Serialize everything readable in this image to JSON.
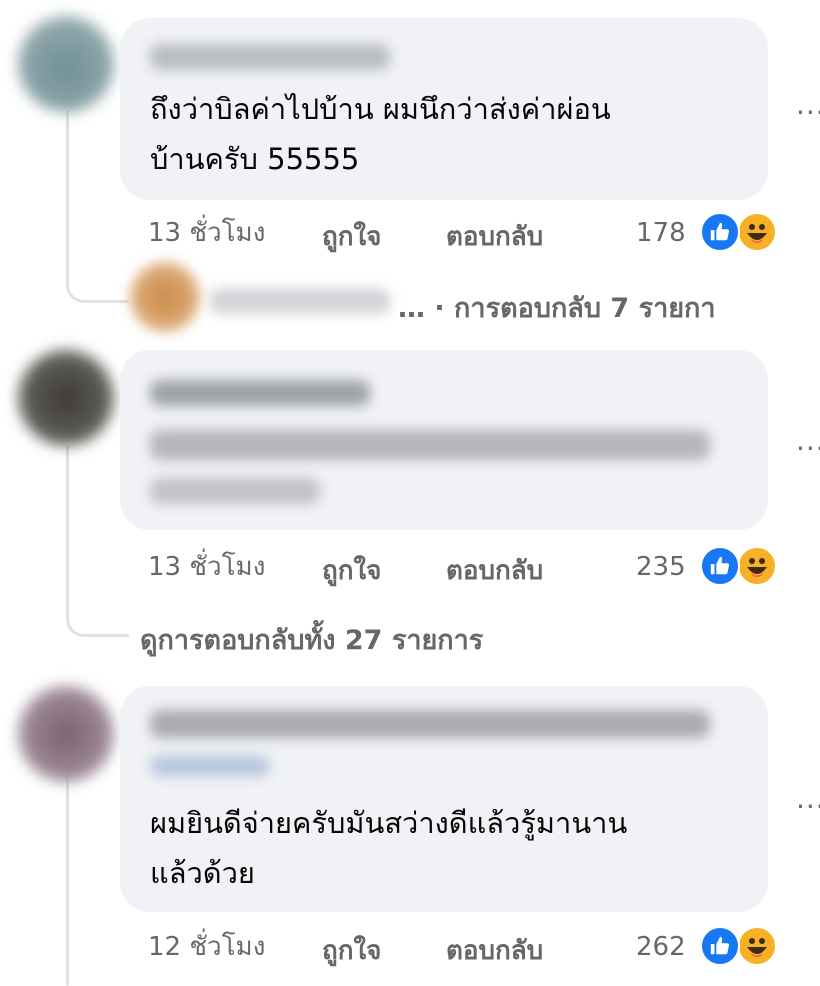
{
  "comments": [
    {
      "text_line1": "ถึงว่าบิลค่าไปบ้าน ผมนึกว่าส่งค่าผ่อน",
      "text_line2": "บ้านครับ 55555",
      "time": "13 ชั่วโมง",
      "like_label": "ถูกใจ",
      "reply_label": "ตอบกลับ",
      "reaction_count": "178",
      "reactions": [
        "like-icon",
        "haha-icon"
      ],
      "more_label": "..."
    },
    {
      "text_line1": "",
      "text_line2": "",
      "time": "13 ชั่วโมง",
      "like_label": "ถูกใจ",
      "reply_label": "ตอบกลับ",
      "reaction_count": "235",
      "reactions": [
        "like-icon",
        "haha-icon"
      ],
      "more_label": "..."
    },
    {
      "text_line1": "ผมยินดีจ่ายครับมันสว่างดีแล้วรู้มานาน",
      "text_line2": "แล้วด้วย",
      "time": "12 ชั่วโมง",
      "like_label": "ถูกใจ",
      "reply_label": "ตอบกลับ",
      "reaction_count": "262",
      "reactions": [
        "like-icon",
        "haha-icon"
      ],
      "more_label": "..."
    }
  ],
  "reply_preview": {
    "label": "… · การตอบกลับ 7 รายกา"
  },
  "view_replies": {
    "label": "ดูการตอบกลับทั้ง 27 รายการ"
  },
  "colors": {
    "bubble": "#f0f2f5",
    "meta_text": "#65676b",
    "like_blue": "#1877f2",
    "haha_yellow": "#f7b125",
    "thread_line": "#dfe1e5"
  }
}
